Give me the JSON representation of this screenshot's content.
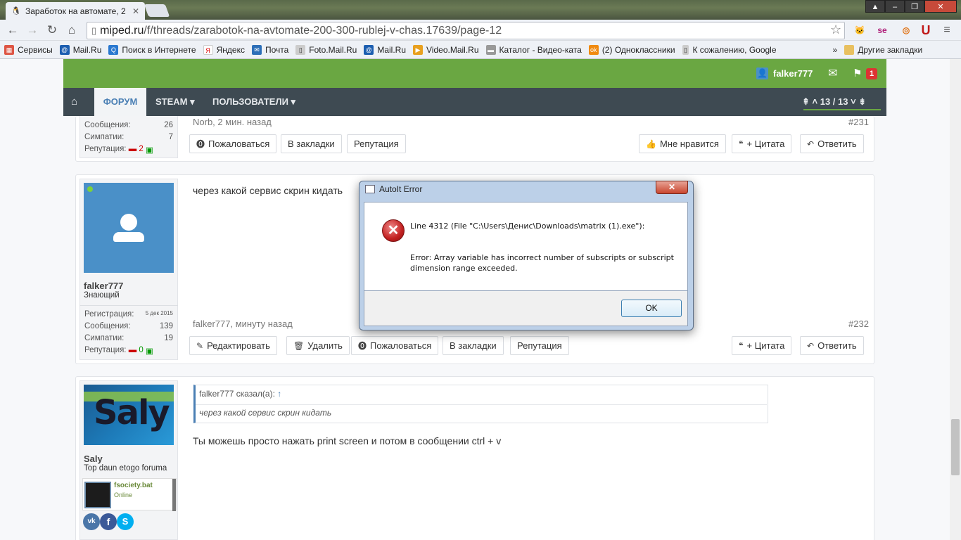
{
  "browser": {
    "tab_title": "Заработок на автомате, 2",
    "url_host": "miped.ru",
    "url_path": "/f/threads/zarabotok-na-avtomate-200-300-rublej-v-chas.17639/page-12",
    "bookmarks": [
      {
        "label": "Сервисы"
      },
      {
        "label": "Mail.Ru"
      },
      {
        "label": "Поиск в Интернете"
      },
      {
        "label": "Яндекс"
      },
      {
        "label": "Почта"
      },
      {
        "label": "Foto.Mail.Ru"
      },
      {
        "label": "Mail.Ru"
      },
      {
        "label": "Video.Mail.Ru"
      },
      {
        "label": "Каталог - Видео-ката"
      },
      {
        "label": "(2) Одноклассники"
      },
      {
        "label": "К сожалению, Google"
      }
    ],
    "other_bookmarks": "Другие закладки",
    "more": "»"
  },
  "header": {
    "username": "falker777",
    "alert_count": "1",
    "nav": {
      "forum": "ФОРУМ",
      "steam": "STEAM",
      "users": "ПОЛЬЗОВАТЕЛИ"
    },
    "pager": "13 / 13"
  },
  "post231": {
    "stats": {
      "messages_label": "Сообщения:",
      "messages": "26",
      "likes_label": "Симпатии:",
      "likes": "7",
      "rep_label": "Репутация:",
      "rep": "2"
    },
    "meta": "Norb, 2 мин. назад",
    "num": "#231",
    "buttons": {
      "report": "Пожаловаться",
      "bookmark": "В закладки",
      "reputation": "Репутация",
      "like": "Мне нравится",
      "quote": "+ Цитата",
      "reply": "Ответить"
    }
  },
  "post232": {
    "text": "через какой сервис скрин кидать",
    "user": "falker777",
    "title": "Знающий",
    "stats": {
      "reg_label": "Регистрация:",
      "reg": "5 дек 2015",
      "messages_label": "Сообщения:",
      "messages": "139",
      "likes_label": "Симпатии:",
      "likes": "19",
      "rep_label": "Репутация:",
      "rep": "0"
    },
    "meta": "falker777, минуту назад",
    "num": "#232",
    "buttons": {
      "edit": "Редактировать",
      "delete": "Удалить",
      "report": "Пожаловаться",
      "bookmark": "В закладки",
      "reputation": "Репутация",
      "quote": "+ Цитата",
      "reply": "Ответить"
    }
  },
  "post233": {
    "user": "Saly",
    "title": "Top daun etogo foruma",
    "avatar_text": "Saly",
    "badge_name": "fsociety.bat",
    "badge_status": "Online",
    "quote_author": "falker777 сказал(а):",
    "quote_arrow": "↑",
    "quote_text": "через какой сервис скрин кидать",
    "text": "Ты можешь просто нажать print screen и потом в сообщении ctrl + v"
  },
  "dialog": {
    "title": "AutoIt Error",
    "line1": "Line 4312  (File \"C:\\Users\\Денис\\Downloads\\matrix (1).exe\"):",
    "line2": "Error: Array variable has incorrect number of subscripts or subscript dimension range exceeded.",
    "ok": "OK",
    "close": "✕"
  },
  "colors": {
    "green": "#6aa742",
    "nav": "#3e4a52",
    "link": "#4a7fb4",
    "avatar_blue": "#4a90c8"
  }
}
